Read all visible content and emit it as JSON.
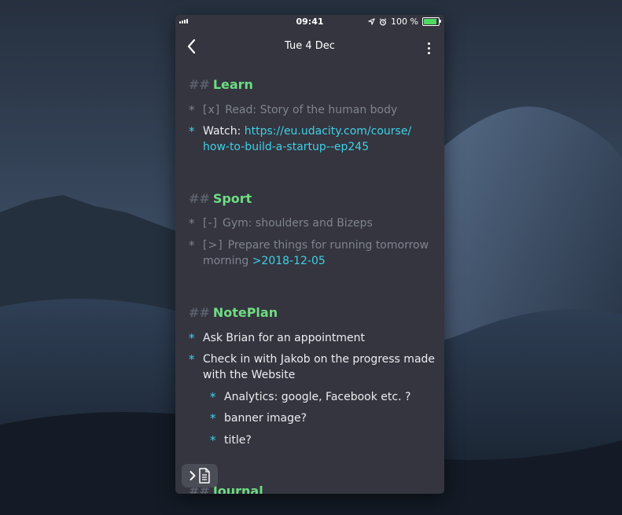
{
  "status_bar": {
    "time": "09:41",
    "battery": "100 %",
    "battery_level": 1.0
  },
  "nav": {
    "title": "Tue 4 Dec",
    "back_icon": "chevron-left-icon",
    "more_icon": "more-vertical-icon"
  },
  "note": {
    "sections": [
      {
        "hash": "##",
        "title": "Learn",
        "items": [
          {
            "bullet": "*",
            "marker": "[x]",
            "text": "Read: Story of the human body",
            "state": "done"
          },
          {
            "bullet": "*",
            "text": "Watch: ",
            "link_line1": "https://eu.udacity.com/course/",
            "link_line2": "how-to-build-a-startup--ep245",
            "state": "open"
          }
        ]
      },
      {
        "hash": "##",
        "title": "Sport",
        "items": [
          {
            "bullet": "*",
            "marker": "[-]",
            "text": "Gym: shoulders and Bizeps",
            "state": "cancelled"
          },
          {
            "bullet": "*",
            "marker": "[>]",
            "text": "Prepare things for running tomorrow",
            "text_line2": "morning ",
            "link": ">2018-12-05",
            "state": "scheduled"
          }
        ]
      },
      {
        "hash": "##",
        "title": "NotePlan",
        "items": [
          {
            "bullet": "*",
            "text": "Ask Brian for an appointment",
            "state": "open"
          },
          {
            "bullet": "*",
            "text": "Check in with Jakob on the progress made",
            "text_line2": "with the Website",
            "state": "open"
          },
          {
            "bullet": "*",
            "text": "Analytics: google, Facebook etc. ?",
            "state": "open",
            "indent": 1
          },
          {
            "bullet": "*",
            "text": "banner image?",
            "state": "open",
            "indent": 1
          },
          {
            "bullet": "*",
            "text": "title?",
            "state": "open",
            "indent": 1
          }
        ]
      },
      {
        "hash": "##",
        "title": "Journal"
      }
    ]
  },
  "fab": {
    "icons": [
      "chevron-right-icon",
      "document-icon"
    ]
  },
  "colors": {
    "background": "#34353f",
    "heading": "#6fdc82",
    "hash": "#5b606b",
    "link": "#3fd0e6",
    "done_text": "#7f838d",
    "open_text": "#ecedf0",
    "battery_fill": "#4cd964"
  }
}
